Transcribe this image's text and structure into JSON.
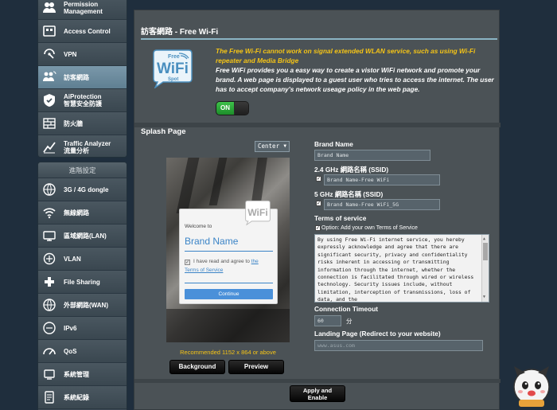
{
  "sidebar": {
    "top_items": [
      {
        "label": "Permission Management",
        "icon": "permission-icon"
      },
      {
        "label": "Access Control",
        "icon": "access-control-icon"
      },
      {
        "label": "VPN",
        "icon": "vpn-icon"
      },
      {
        "label": "訪客網路",
        "icon": "guest-network-icon"
      },
      {
        "label_line1": "AiProtection",
        "label_line2": "智慧安全防護",
        "icon": "aiprotection-icon"
      },
      {
        "label": "防火牆",
        "icon": "firewall-icon"
      },
      {
        "label_line1": "Traffic Analyzer",
        "label_line2": "流量分析",
        "icon": "traffic-analyzer-icon"
      }
    ],
    "advanced_header": "進階設定",
    "bottom_items": [
      {
        "label": "3G / 4G dongle",
        "icon": "dongle-icon"
      },
      {
        "label": "無線網路",
        "icon": "wireless-icon"
      },
      {
        "label": "區域網路(LAN)",
        "icon": "lan-icon"
      },
      {
        "label": "VLAN",
        "icon": "vlan-icon"
      },
      {
        "label": "File Sharing",
        "icon": "file-sharing-icon"
      },
      {
        "label": "外部網路(WAN)",
        "icon": "wan-icon"
      },
      {
        "label": "IPv6",
        "icon": "ipv6-icon"
      },
      {
        "label": "QoS",
        "icon": "qos-icon"
      },
      {
        "label": "系統管理",
        "icon": "admin-icon"
      },
      {
        "label": "系統紀錄",
        "icon": "syslog-icon"
      }
    ]
  },
  "main": {
    "title": "訪客網路 - Free Wi-Fi",
    "logo": {
      "line1": "Free",
      "line2": "WiFi",
      "line3": "Spot"
    },
    "warning": "The Free Wi-Fi cannot work on signal extended WLAN service, such as using Wi-Fi repeater and Media Bridge",
    "description": "Free WiFi provides you a easy way to create a vistor WiFi network and promote your brand. A web page is displayed to a guest user who tries to access the internet. The user has to accept company's network useage policy in the web page.",
    "toggle_label": "ON",
    "splash_label": "Splash Page",
    "align_value": "Center",
    "preview": {
      "welcome": "Welcome to",
      "brand": "Brand Name",
      "agree_prefix": "I have read and agree to",
      "agree_link1": "the",
      "agree_link2": "Terms of Service",
      "continue": "Continue"
    },
    "recommend": "Recommended 1152 x 864 or above",
    "background_btn": "Background",
    "preview_btn": "Preview",
    "apply_line1": "Apply and",
    "apply_line2": "Enable",
    "form": {
      "brand_label": "Brand Name",
      "brand_value": "Brand Name",
      "ssid24_label": "2.4 GHz 網路名稱 (SSID)",
      "ssid24_value": "Brand Name-Free WiFi",
      "ssid5_label": "5 GHz 網路名稱 (SSID)",
      "ssid5_value": "Brand Name-Free WiFi_5G",
      "terms_label": "Terms of service",
      "terms_option": "Option: Add your own Terms of Service",
      "terms_text": "By using Free Wi-Fi internet service, you hereby expressly acknowledge and agree that there are significant security, privacy and confidentiality risks inherent in accessing or transmitting information through the internet, whether the connection is facilitated through wired or wireless technology. Security issues include, without limitation, interception of transmissions, loss of data, and the",
      "timeout_label": "Connection Timeout",
      "timeout_value": "60",
      "timeout_unit": "分",
      "landing_label": "Landing Page (Redirect to your website)",
      "landing_placeholder": "www.asus.com"
    }
  },
  "colors": {
    "accent_yellow": "#f5c416",
    "toggle_green": "#2aa33a",
    "title_rule": "#8ab4c4"
  }
}
